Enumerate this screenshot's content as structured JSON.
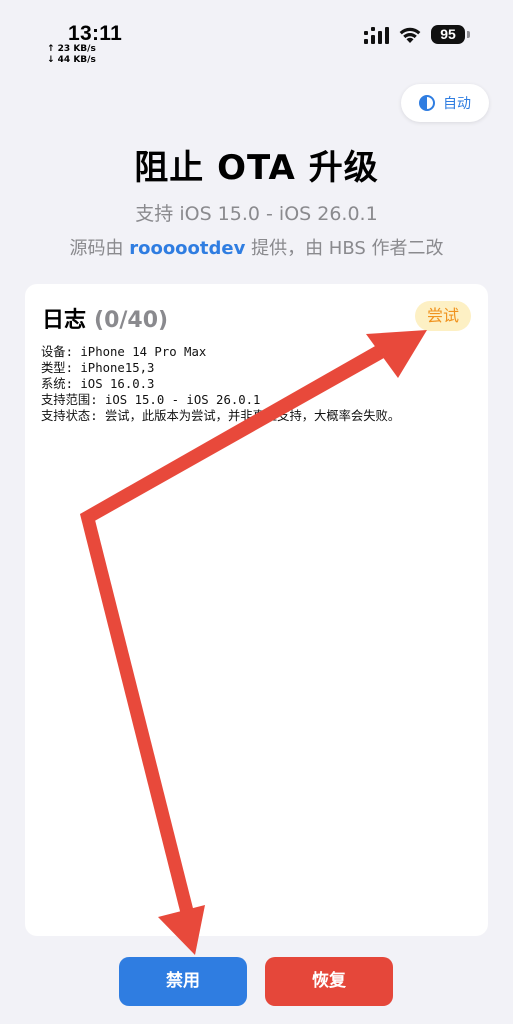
{
  "status_bar": {
    "time": "13:11",
    "upload_speed": "↑ 23 KB/s",
    "download_speed": "↓ 44 KB/s",
    "battery": "95",
    "icons": [
      "cellular-signal-icon",
      "wifi-icon",
      "battery-icon"
    ]
  },
  "theme_toggle": {
    "label": "自动",
    "icon": "half-circle-contrast-icon"
  },
  "header": {
    "title": "阻止 OTA 升级",
    "subtitle": "支持 iOS 15.0 - iOS 26.0.1",
    "credit_prefix": "源码由 ",
    "credit_author": "roooootdev",
    "credit_suffix": " 提供，由 HBS 作者二改"
  },
  "log": {
    "title": "日志",
    "count": "(0/40)",
    "status_badge": "尝试",
    "lines": [
      "设备: iPhone 14 Pro Max",
      "类型: iPhone15,3",
      "系统: iOS 16.0.3",
      "支持范围: iOS 15.0 - iOS 26.0.1",
      "支持状态: 尝试，此版本为尝试，并非真正支持，大概率会失败。"
    ]
  },
  "buttons": {
    "disable_label": "禁用",
    "restore_label": "恢复"
  },
  "colors": {
    "accent_blue": "#2f7de1",
    "danger_red": "#e5473a",
    "annotation_arrow": "#e8493b",
    "badge_bg": "#fdf0c4",
    "badge_text": "#f0921e"
  }
}
